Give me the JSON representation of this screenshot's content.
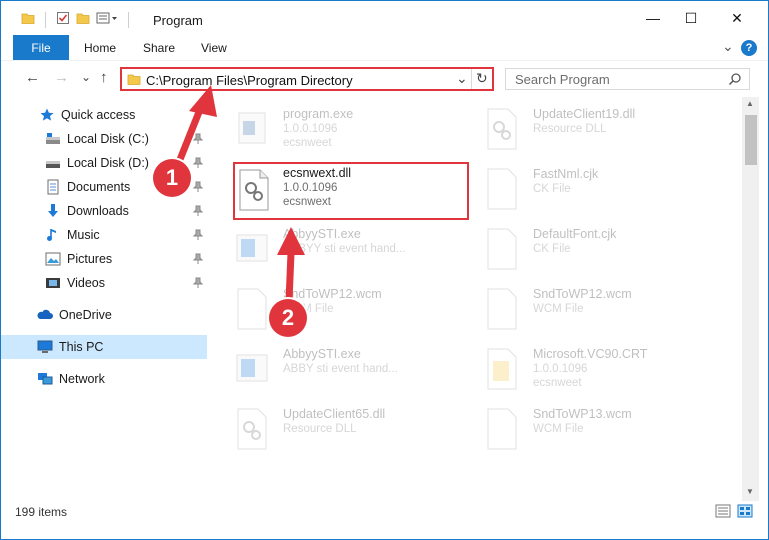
{
  "window": {
    "title": "Program",
    "controls": {
      "minimize": "—",
      "maximize": "☐",
      "close": "✕"
    }
  },
  "ribbon": {
    "file": "File",
    "tabs": [
      "Home",
      "Share",
      "View"
    ],
    "help": "?",
    "collapse": "⌄"
  },
  "address": {
    "path": "C:\\Program Files\\Program Directory",
    "refresh": "↻",
    "dropdown": "⌄"
  },
  "search": {
    "placeholder": "Search Program",
    "icon": "search-icon"
  },
  "nav": {
    "back": "←",
    "forward": "→",
    "recent": "⌄",
    "up": "↑",
    "items": [
      {
        "label": "Quick access",
        "icon": "star-icon",
        "pinned": false
      },
      {
        "label": "Local Disk (C:)",
        "icon": "drive-icon",
        "pinned": true
      },
      {
        "label": "Local Disk (D:)",
        "icon": "drive-icon",
        "pinned": true
      },
      {
        "label": "Documents",
        "icon": "documents-icon",
        "pinned": true
      },
      {
        "label": "Downloads",
        "icon": "download-icon",
        "pinned": true
      },
      {
        "label": "Music",
        "icon": "music-icon",
        "pinned": true
      },
      {
        "label": "Pictures",
        "icon": "pictures-icon",
        "pinned": true
      },
      {
        "label": "Videos",
        "icon": "videos-icon",
        "pinned": true
      },
      {
        "label": "OneDrive",
        "icon": "cloud-icon",
        "pinned": false
      },
      {
        "label": "This PC",
        "icon": "pc-icon",
        "pinned": false
      },
      {
        "label": "Network",
        "icon": "network-icon",
        "pinned": false
      }
    ]
  },
  "files": {
    "left": [
      {
        "name": "program.exe",
        "line2": "1.0.0.1096",
        "line3": "ecsnweet",
        "icon": "exe-icon"
      },
      {
        "name": "ecsnwext.dll",
        "line2": "1.0.0.1096",
        "line3": "ecsnwext",
        "icon": "dll-icon"
      },
      {
        "name": "AbbyySTI.exe",
        "line2": "ABBYY sti event hand...",
        "line3": "",
        "icon": "exe-icon"
      },
      {
        "name": "SndToWP12.wcm",
        "line2": "WCM File",
        "line3": "",
        "icon": "blank-file-icon"
      },
      {
        "name": "AbbyySTI.exe",
        "line2": "ABBY sti event hand...",
        "line3": "",
        "icon": "exe-icon"
      },
      {
        "name": "UpdateClient65.dll",
        "line2": "Resource DLL",
        "line3": "",
        "icon": "dll-icon"
      }
    ],
    "right": [
      {
        "name": "UpdateClient19.dll",
        "line2": "Resource DLL",
        "line3": "",
        "icon": "dll-icon"
      },
      {
        "name": "FastNml.cjk",
        "line2": "CK File",
        "line3": "",
        "icon": "blank-file-icon"
      },
      {
        "name": "DefaultFont.cjk",
        "line2": "CK File",
        "line3": "",
        "icon": "blank-file-icon"
      },
      {
        "name": "SndToWP12.wcm",
        "line2": "WCM File",
        "line3": "",
        "icon": "blank-file-icon"
      },
      {
        "name": "Microsoft.VC90.CRT",
        "line2": "1.0.0.1096",
        "line3": "ecsnweet",
        "icon": "folder-file-icon"
      },
      {
        "name": "SndToWP13.wcm",
        "line2": "WCM File",
        "line3": "",
        "icon": "blank-file-icon"
      }
    ]
  },
  "status": {
    "count": "199 items"
  },
  "annotations": {
    "step1": "1",
    "step2": "2",
    "color": "#e0353c"
  }
}
